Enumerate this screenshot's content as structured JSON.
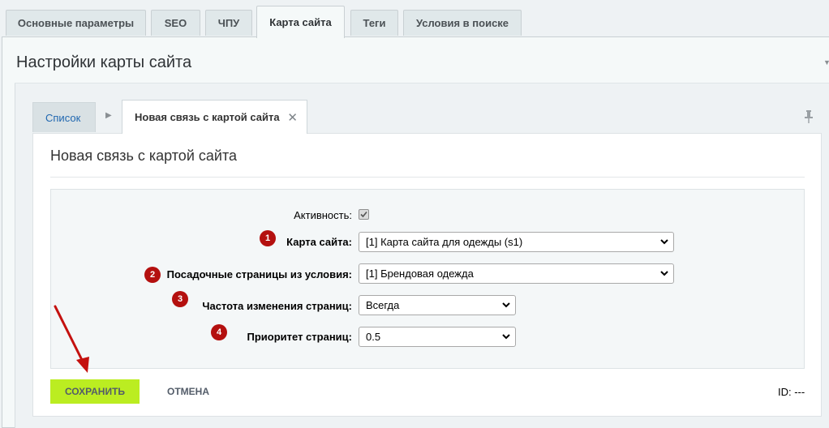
{
  "top_tabs": [
    {
      "label": "Основные параметры"
    },
    {
      "label": "SEO"
    },
    {
      "label": "ЧПУ"
    },
    {
      "label": "Карта сайта",
      "active": true
    },
    {
      "label": "Теги"
    },
    {
      "label": "Условия в поиске"
    }
  ],
  "section": {
    "title": "Настройки карты сайта"
  },
  "inner_tabs": {
    "list_label": "Список",
    "new_label": "Новая связь с картой сайта",
    "close_glyph": "✕"
  },
  "form": {
    "heading": "Новая связь с картой сайта",
    "activity_label": "Активность:",
    "activity_checked": true,
    "fields": [
      {
        "badge": "1",
        "label": "Карта сайта:",
        "value": "[1] Карта сайта для одежды (s1)"
      },
      {
        "badge": "2",
        "label": "Посадочные страницы из условия:",
        "value": "[1] Брендовая одежда"
      },
      {
        "badge": "3",
        "label": "Частота изменения страниц:",
        "value": "Всегда"
      },
      {
        "badge": "4",
        "label": "Приоритет страниц:",
        "value": "0.5"
      }
    ]
  },
  "actions": {
    "save_label": "СОХРАНИТЬ",
    "cancel_label": "ОТМЕНА"
  },
  "id_text": "ID: ---",
  "colors": {
    "save_button": "#bbed21",
    "badge": "#b4100f",
    "annotation_arrow": "#c4110f",
    "link": "#2067b0"
  },
  "icons": {
    "pin": "pin-icon",
    "collapse": "collapse-arrow-icon",
    "arrow": "annotation-arrow"
  }
}
